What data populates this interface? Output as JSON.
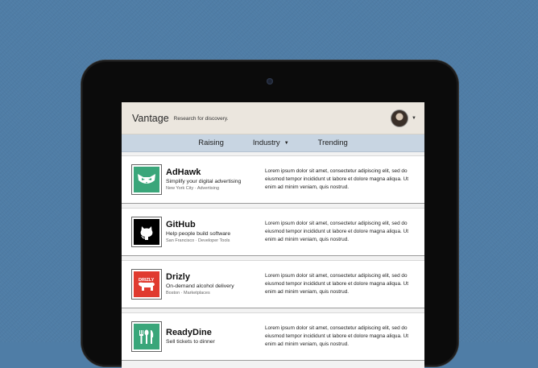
{
  "header": {
    "brand": "Vantage",
    "tagline": "Research for discovery."
  },
  "nav": {
    "items": [
      {
        "label": "Raising"
      },
      {
        "label": "Industry"
      },
      {
        "label": "Trending"
      }
    ]
  },
  "companies": [
    {
      "name": "AdHawk",
      "tagline": "Simplify your digital advertising",
      "location": "New York City · Advertising",
      "description": "Lorem ipsum dolor sit amet, consectetur adipiscing elit, sed do eiusmod tempor incididunt ut labore et dolore magna aliqua. Ut enim ad minim veniam, quis nostrud.",
      "logo_icon": "owl-icon",
      "logo_bg": "#3aa67a"
    },
    {
      "name": "GitHub",
      "tagline": "Help people build software",
      "location": "San Francisco · Developer Tools",
      "description": "Lorem ipsum dolor sit amet, consectetur adipiscing elit, sed do eiusmod tempor incididunt ut labore et dolore magna aliqua. Ut enim ad minim veniam, quis nostrud.",
      "logo_icon": "octocat-icon",
      "logo_bg": "#000000"
    },
    {
      "name": "Drizly",
      "tagline": "On-demand alcohol delivery",
      "location": "Boston · Marketplaces",
      "description": "Lorem ipsum dolor sit amet, consectetur adipiscing elit, sed do eiusmod tempor incididunt ut labore et dolore magna aliqua. Ut enim ad minim veniam, quis nostrud.",
      "logo_icon": "bear-icon",
      "logo_text": "DRIZLY",
      "logo_bg": "#e03a2f"
    },
    {
      "name": "ReadyDine",
      "tagline": "Sell tickets to dinner",
      "location": "",
      "description": "Lorem ipsum dolor sit amet, consectetur adipiscing elit, sed do eiusmod tempor incididunt ut labore et dolore magna aliqua. Ut enim ad minim veniam, quis nostrud.",
      "logo_icon": "fork-spoon-knife-icon",
      "logo_bg": "#3aa67a"
    }
  ]
}
